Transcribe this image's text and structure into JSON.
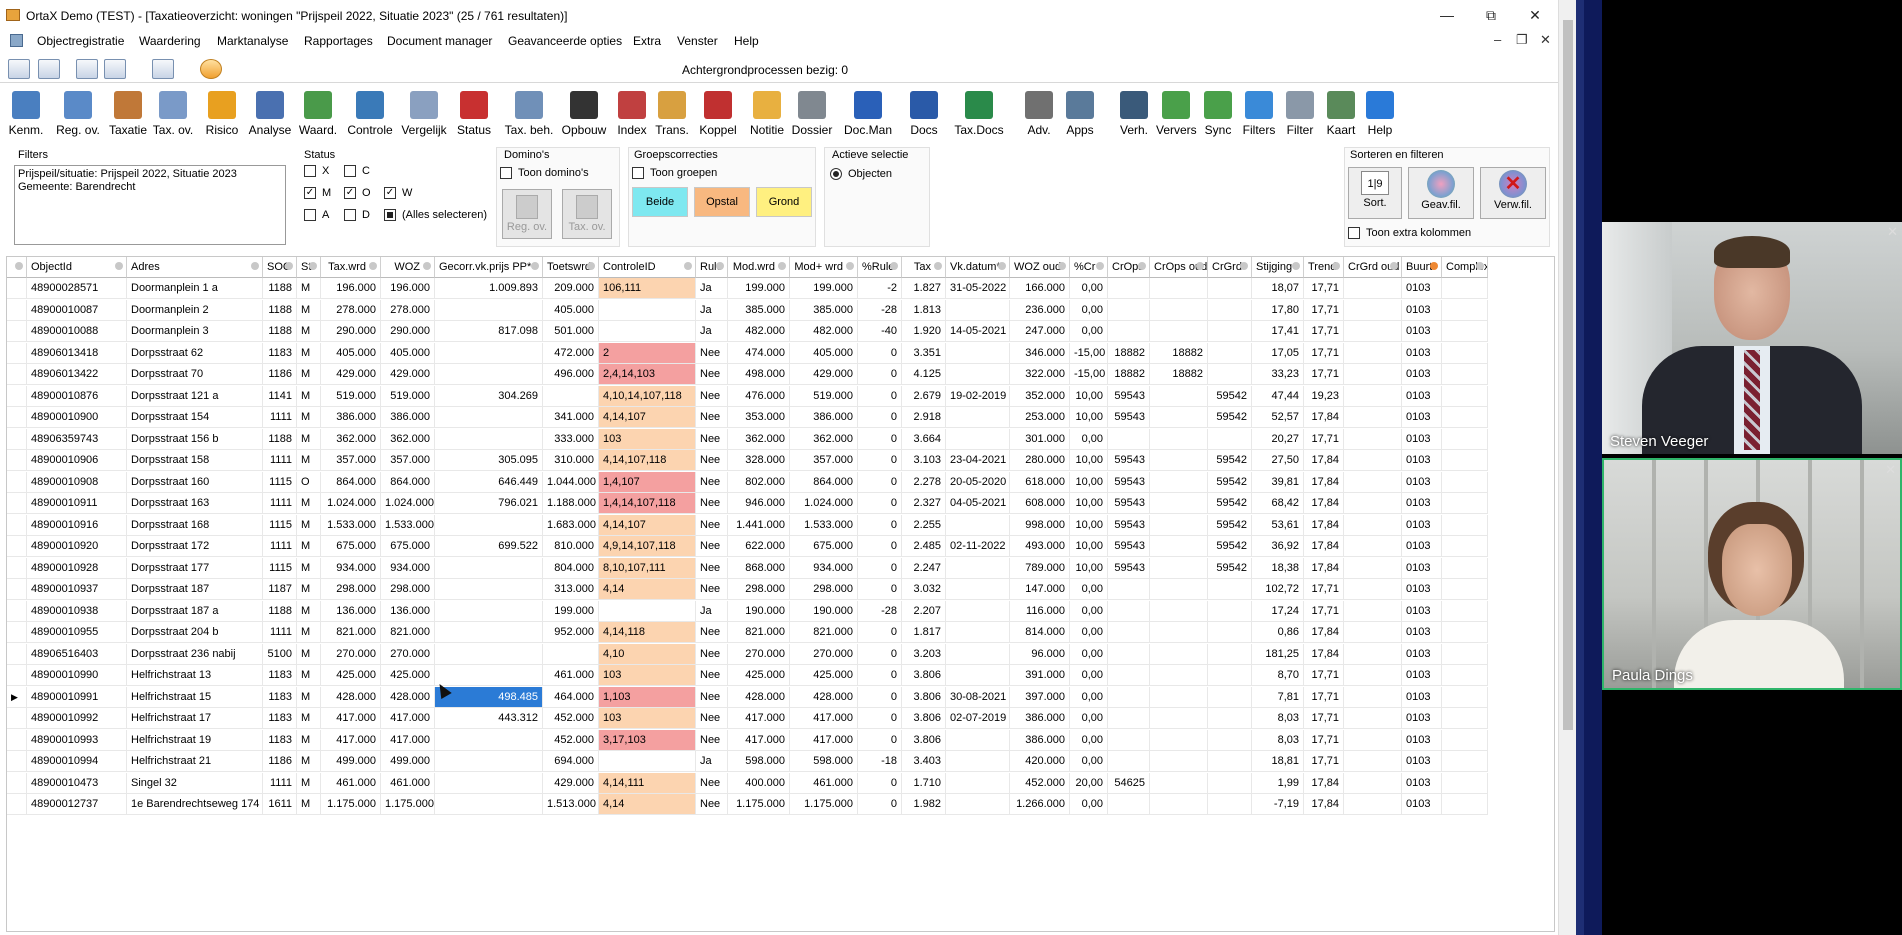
{
  "window": {
    "title": "OrtaX Demo (TEST) - [Taxatieoverzicht: woningen \"Prijspeil 2022, Situatie 2023\" (25 / 761 resultaten)]",
    "minimize": "—",
    "maximize": "⧉",
    "close": "✕"
  },
  "menu": [
    "Objectregistratie",
    "Waardering",
    "Marktanalyse",
    "Rapportages",
    "Document manager",
    "Geavanceerde opties",
    "Extra",
    "Venster",
    "Help"
  ],
  "mdi": {
    "min": "–",
    "restore": "❐",
    "close": "✕"
  },
  "status_bg": "Achtergrondprocessen bezig: 0",
  "ribbon": [
    {
      "label": "Kenm.",
      "icon": "chart-doc-icon",
      "color": "#4a7fc0"
    },
    {
      "label": "Reg. ov.",
      "icon": "register-icon",
      "color": "#5a8ac8"
    },
    {
      "label": "Taxatie",
      "icon": "house-icon",
      "color": "#c07838"
    },
    {
      "label": "Tax. ov.",
      "icon": "copy-docs-icon",
      "color": "#7a9ac8"
    },
    {
      "label": "Risico",
      "icon": "warning-lamp-icon",
      "color": "#e8a020"
    },
    {
      "label": "Analyse",
      "icon": "fx-analyse-icon",
      "color": "#4a70b0"
    },
    {
      "label": "Waard.",
      "icon": "fx-value-icon",
      "color": "#4a9a4a"
    },
    {
      "label": "Controle",
      "icon": "checkbox-icon",
      "color": "#3a7ab8"
    },
    {
      "label": "Vergelijk",
      "icon": "compare-icon",
      "color": "#8aa0c0"
    },
    {
      "label": "Status",
      "icon": "badge-icon",
      "color": "#c83030"
    },
    {
      "label": "Tax. beh.",
      "icon": "tag-icon",
      "color": "#7090b8"
    },
    {
      "label": "Opbouw",
      "icon": "fx-icon",
      "color": "#333333"
    },
    {
      "label": "Index",
      "icon": "line-chart-icon",
      "color": "#c04040"
    },
    {
      "label": "Trans.",
      "icon": "handshake-icon",
      "color": "#d8a040"
    },
    {
      "label": "Koppel",
      "icon": "link-icon",
      "color": "#c03030"
    },
    {
      "label": "Notitie",
      "icon": "note-icon",
      "color": "#e8b040"
    },
    {
      "label": "Dossier",
      "icon": "archive-icon",
      "color": "#808890"
    },
    {
      "label": "Doc.Man",
      "icon": "w-icon",
      "color": "#2a60b8"
    },
    {
      "label": "Docs",
      "icon": "word-icon",
      "color": "#2a5aa8"
    },
    {
      "label": "Tax.Docs",
      "icon": "excel-icon",
      "color": "#2a8a4a"
    },
    {
      "label": "Adv.",
      "icon": "list-icon",
      "color": "#707070"
    },
    {
      "label": "Apps",
      "icon": "picture-icon",
      "color": "#5a7a9a"
    },
    {
      "label": "Verh.",
      "icon": "trend-icon",
      "color": "#3a5a7a"
    },
    {
      "label": "Ververs",
      "icon": "refresh-icon",
      "color": "#4aa04a"
    },
    {
      "label": "Sync",
      "icon": "sync-icon",
      "color": "#4aa04a"
    },
    {
      "label": "Filters",
      "icon": "funnel-icon",
      "color": "#3a8ad8"
    },
    {
      "label": "Filter",
      "icon": "database-icon",
      "color": "#8a98a8"
    },
    {
      "label": "Kaart",
      "icon": "map-icon",
      "color": "#5a8a5a"
    },
    {
      "label": "Help",
      "icon": "help-icon",
      "color": "#2a7ad8"
    }
  ],
  "panels": {
    "filters": {
      "title": "Filters",
      "lines": [
        "Prijspeil/situatie: Prijspeil 2022, Situatie 2023",
        "Gemeente: Barendrecht"
      ]
    },
    "status": {
      "title": "Status",
      "items": [
        {
          "label": "X",
          "checked": false
        },
        {
          "label": "C",
          "checked": false
        },
        {
          "label": "M",
          "checked": true
        },
        {
          "label": "O",
          "checked": true
        },
        {
          "label": "W",
          "checked": true
        },
        {
          "label": "A",
          "checked": false
        },
        {
          "label": "D",
          "checked": false
        },
        {
          "label": "(Alles selecteren)",
          "checked": "partial"
        }
      ]
    },
    "dominos": {
      "title": "Domino's",
      "toggle": "Toon domino's",
      "btn1": "Reg. ov.",
      "btn2": "Tax. ov."
    },
    "groeps": {
      "title": "Groepscorrecties",
      "toggle": "Toon groepen",
      "b1": "Beide",
      "b2": "Opstal",
      "b3": "Grond",
      "c1": "#7ee8f0",
      "c2": "#f8b880",
      "c3": "#fff080"
    },
    "actief": {
      "title": "Actieve selectie",
      "option": "Objecten"
    },
    "sort": {
      "title": "Sorteren en filteren",
      "b1": "Sort.",
      "b2": "Geav.fil.",
      "b3": "Verw.fil.",
      "extra": "Toon extra kolommen",
      "sorticon": "1|9"
    }
  },
  "columns": [
    "ObjectId",
    "Adres",
    "SOC",
    "St",
    "Tax.wrd",
    "WOZ",
    "Gecorr.vk.prijs PP*",
    "Toetswrd",
    "ControleID",
    "Rule",
    "Mod.wrd",
    "Mod+ wrd",
    "%Rule",
    "Tax",
    "Vk.datum*",
    "WOZ oud",
    "%Cr",
    "CrOps",
    "CrOps oud",
    "CrGrd",
    "Stijging",
    "Trend",
    "CrGrd oud",
    "Buurt",
    "Complex"
  ],
  "rows": [
    [
      "48900028571",
      "Doormanplein 1 a",
      "1188",
      "M",
      "196.000",
      "196.000",
      "1.009.893",
      "209.000",
      "106,111",
      "Ja",
      "199.000",
      "199.000",
      "-2",
      "1.827",
      "31-05-2022",
      "166.000",
      "0,00",
      "",
      "",
      "",
      "18,07",
      "17,71",
      "",
      "0103",
      "",
      "peach"
    ],
    [
      "48900010087",
      "Doormanplein 2",
      "1188",
      "M",
      "278.000",
      "278.000",
      "",
      "405.000",
      "",
      "Ja",
      "385.000",
      "385.000",
      "-28",
      "1.813",
      "",
      "236.000",
      "0,00",
      "",
      "",
      "",
      "17,80",
      "17,71",
      "",
      "0103",
      "",
      ""
    ],
    [
      "48900010088",
      "Doormanplein 3",
      "1188",
      "M",
      "290.000",
      "290.000",
      "817.098",
      "501.000",
      "",
      "Ja",
      "482.000",
      "482.000",
      "-40",
      "1.920",
      "14-05-2021",
      "247.000",
      "0,00",
      "",
      "",
      "",
      "17,41",
      "17,71",
      "",
      "0103",
      "",
      ""
    ],
    [
      "48906013418",
      "Dorpsstraat 62",
      "1183",
      "M",
      "405.000",
      "405.000",
      "",
      "472.000",
      "2",
      "Nee",
      "474.000",
      "405.000",
      "0",
      "3.351",
      "",
      "346.000",
      "-15,00",
      "18882",
      "18882",
      "",
      "17,05",
      "17,71",
      "",
      "0103",
      "",
      "pink"
    ],
    [
      "48906013422",
      "Dorpsstraat 70",
      "1186",
      "M",
      "429.000",
      "429.000",
      "",
      "496.000",
      "2,4,14,103",
      "Nee",
      "498.000",
      "429.000",
      "0",
      "4.125",
      "",
      "322.000",
      "-15,00",
      "18882",
      "18882",
      "",
      "33,23",
      "17,71",
      "",
      "0103",
      "",
      "pink"
    ],
    [
      "48900010876",
      "Dorpsstraat 121 a",
      "1141",
      "M",
      "519.000",
      "519.000",
      "304.269",
      "",
      "4,10,14,107,118",
      "Nee",
      "476.000",
      "519.000",
      "0",
      "2.679",
      "19-02-2019",
      "352.000",
      "10,00",
      "59543",
      "",
      "59542",
      "47,44",
      "19,23",
      "",
      "0103",
      "",
      "peach"
    ],
    [
      "48900010900",
      "Dorpsstraat 154",
      "1111",
      "M",
      "386.000",
      "386.000",
      "",
      "341.000",
      "4,14,107",
      "Nee",
      "353.000",
      "386.000",
      "0",
      "2.918",
      "",
      "253.000",
      "10,00",
      "59543",
      "",
      "59542",
      "52,57",
      "17,84",
      "",
      "0103",
      "",
      "peach"
    ],
    [
      "48906359743",
      "Dorpsstraat 156 b",
      "1188",
      "M",
      "362.000",
      "362.000",
      "",
      "333.000",
      "103",
      "Nee",
      "362.000",
      "362.000",
      "0",
      "3.664",
      "",
      "301.000",
      "0,00",
      "",
      "",
      "",
      "20,27",
      "17,71",
      "",
      "0103",
      "",
      "peach"
    ],
    [
      "48900010906",
      "Dorpsstraat 158",
      "1111",
      "M",
      "357.000",
      "357.000",
      "305.095",
      "310.000",
      "4,14,107,118",
      "Nee",
      "328.000",
      "357.000",
      "0",
      "3.103",
      "23-04-2021",
      "280.000",
      "10,00",
      "59543",
      "",
      "59542",
      "27,50",
      "17,84",
      "",
      "0103",
      "",
      "peach"
    ],
    [
      "48900010908",
      "Dorpsstraat 160",
      "1115",
      "O",
      "864.000",
      "864.000",
      "646.449",
      "1.044.000",
      "1,4,107",
      "Nee",
      "802.000",
      "864.000",
      "0",
      "2.278",
      "20-05-2020",
      "618.000",
      "10,00",
      "59543",
      "",
      "59542",
      "39,81",
      "17,84",
      "",
      "0103",
      "",
      "pink"
    ],
    [
      "48900010911",
      "Dorpsstraat 163",
      "1111",
      "M",
      "1.024.000",
      "1.024.000",
      "796.021",
      "1.188.000",
      "1,4,14,107,118",
      "Nee",
      "946.000",
      "1.024.000",
      "0",
      "2.327",
      "04-05-2021",
      "608.000",
      "10,00",
      "59543",
      "",
      "59542",
      "68,42",
      "17,84",
      "",
      "0103",
      "",
      "pink"
    ],
    [
      "48900010916",
      "Dorpsstraat 168",
      "1115",
      "M",
      "1.533.000",
      "1.533.000",
      "",
      "1.683.000",
      "4,14,107",
      "Nee",
      "1.441.000",
      "1.533.000",
      "0",
      "2.255",
      "",
      "998.000",
      "10,00",
      "59543",
      "",
      "59542",
      "53,61",
      "17,84",
      "",
      "0103",
      "",
      "peach"
    ],
    [
      "48900010920",
      "Dorpsstraat 172",
      "1111",
      "M",
      "675.000",
      "675.000",
      "699.522",
      "810.000",
      "4,9,14,107,118",
      "Nee",
      "622.000",
      "675.000",
      "0",
      "2.485",
      "02-11-2022",
      "493.000",
      "10,00",
      "59543",
      "",
      "59542",
      "36,92",
      "17,84",
      "",
      "0103",
      "",
      "peach"
    ],
    [
      "48900010928",
      "Dorpsstraat 177",
      "1115",
      "M",
      "934.000",
      "934.000",
      "",
      "804.000",
      "8,10,107,111",
      "Nee",
      "868.000",
      "934.000",
      "0",
      "2.247",
      "",
      "789.000",
      "10,00",
      "59543",
      "",
      "59542",
      "18,38",
      "17,84",
      "",
      "0103",
      "",
      "peach"
    ],
    [
      "48900010937",
      "Dorpsstraat 187",
      "1187",
      "M",
      "298.000",
      "298.000",
      "",
      "313.000",
      "4,14",
      "Nee",
      "298.000",
      "298.000",
      "0",
      "3.032",
      "",
      "147.000",
      "0,00",
      "",
      "",
      "",
      "102,72",
      "17,71",
      "",
      "0103",
      "",
      "peach"
    ],
    [
      "48900010938",
      "Dorpsstraat 187 a",
      "1188",
      "M",
      "136.000",
      "136.000",
      "",
      "199.000",
      "",
      "Ja",
      "190.000",
      "190.000",
      "-28",
      "2.207",
      "",
      "116.000",
      "0,00",
      "",
      "",
      "",
      "17,24",
      "17,71",
      "",
      "0103",
      "",
      ""
    ],
    [
      "48900010955",
      "Dorpsstraat 204 b",
      "1111",
      "M",
      "821.000",
      "821.000",
      "",
      "952.000",
      "4,14,118",
      "Nee",
      "821.000",
      "821.000",
      "0",
      "1.817",
      "",
      "814.000",
      "0,00",
      "",
      "",
      "",
      "0,86",
      "17,84",
      "",
      "0103",
      "",
      "peach"
    ],
    [
      "48906516403",
      "Dorpsstraat 236 nabij",
      "5100",
      "M",
      "270.000",
      "270.000",
      "",
      "",
      "4,10",
      "Nee",
      "270.000",
      "270.000",
      "0",
      "3.203",
      "",
      "96.000",
      "0,00",
      "",
      "",
      "",
      "181,25",
      "17,84",
      "",
      "0103",
      "",
      "peach"
    ],
    [
      "48900010990",
      "Helfrichstraat 13",
      "1183",
      "M",
      "425.000",
      "425.000",
      "",
      "461.000",
      "103",
      "Nee",
      "425.000",
      "425.000",
      "0",
      "3.806",
      "",
      "391.000",
      "0,00",
      "",
      "",
      "",
      "8,70",
      "17,71",
      "",
      "0103",
      "",
      "peach"
    ],
    [
      "48900010991",
      "Helfrichstraat 15",
      "1183",
      "M",
      "428.000",
      "428.000",
      "498.485",
      "464.000",
      "1,103",
      "Nee",
      "428.000",
      "428.000",
      "0",
      "3.806",
      "30-08-2021",
      "397.000",
      "0,00",
      "",
      "",
      "",
      "7,81",
      "17,71",
      "",
      "0103",
      "",
      "pink"
    ],
    [
      "48900010992",
      "Helfrichstraat 17",
      "1183",
      "M",
      "417.000",
      "417.000",
      "443.312",
      "452.000",
      "103",
      "Nee",
      "417.000",
      "417.000",
      "0",
      "3.806",
      "02-07-2019",
      "386.000",
      "0,00",
      "",
      "",
      "",
      "8,03",
      "17,71",
      "",
      "0103",
      "",
      "peach"
    ],
    [
      "48900010993",
      "Helfrichstraat 19",
      "1183",
      "M",
      "417.000",
      "417.000",
      "",
      "452.000",
      "3,17,103",
      "Nee",
      "417.000",
      "417.000",
      "0",
      "3.806",
      "",
      "386.000",
      "0,00",
      "",
      "",
      "",
      "8,03",
      "17,71",
      "",
      "0103",
      "",
      "pink"
    ],
    [
      "48900010994",
      "Helfrichstraat 21",
      "1186",
      "M",
      "499.000",
      "499.000",
      "",
      "694.000",
      "",
      "Ja",
      "598.000",
      "598.000",
      "-18",
      "3.403",
      "",
      "420.000",
      "0,00",
      "",
      "",
      "",
      "18,81",
      "17,71",
      "",
      "0103",
      "",
      ""
    ],
    [
      "48900010473",
      "Singel 32",
      "1111",
      "M",
      "461.000",
      "461.000",
      "",
      "429.000",
      "4,14,111",
      "Nee",
      "400.000",
      "461.000",
      "0",
      "1.710",
      "",
      "452.000",
      "20,00",
      "54625",
      "",
      "",
      "1,99",
      "17,84",
      "",
      "0103",
      "",
      "peach"
    ],
    [
      "48900012737",
      "1e Barendrechtseweg 174",
      "1611",
      "M",
      "1.175.000",
      "1.175.000",
      "",
      "1.513.000",
      "4,14",
      "Nee",
      "1.175.000",
      "1.175.000",
      "0",
      "1.982",
      "",
      "1.266.000",
      "0,00",
      "",
      "",
      "",
      "-7,19",
      "17,84",
      "",
      "0103",
      "",
      "peach"
    ]
  ],
  "current_row_marker": "▶",
  "participants": [
    {
      "name": "Steven Veeger"
    },
    {
      "name": "Paula Dings"
    }
  ]
}
